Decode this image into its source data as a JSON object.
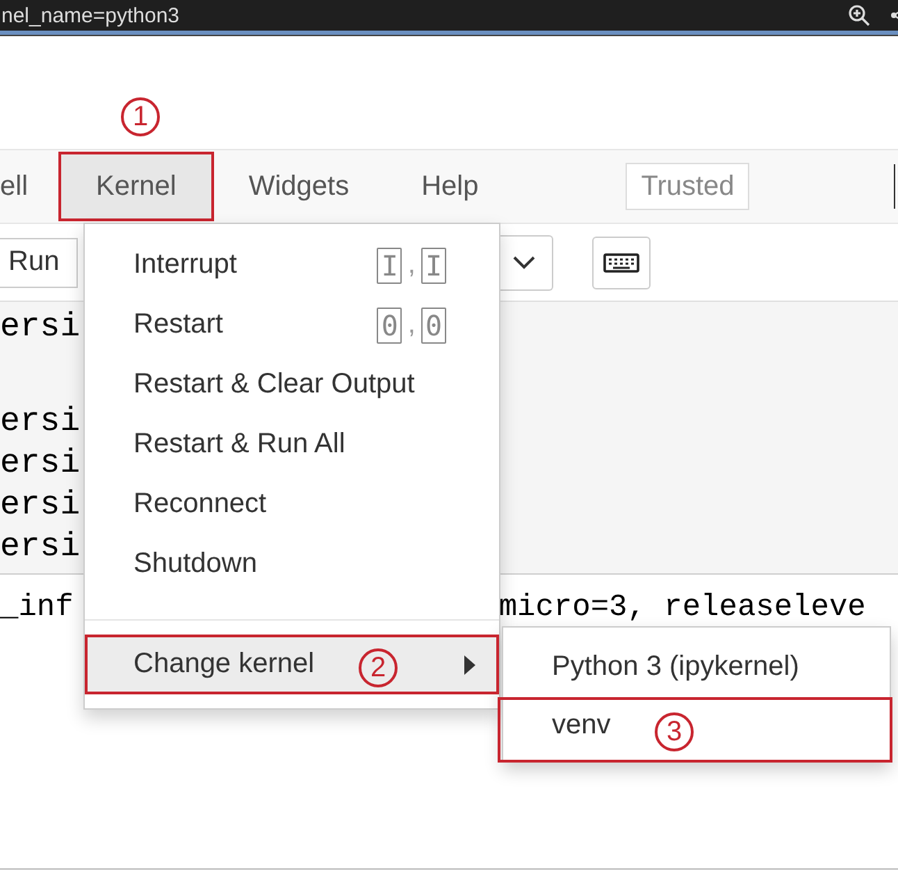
{
  "browser_bar": {
    "url": "nel_name=python3"
  },
  "menubar": {
    "items": [
      {
        "label": "ell",
        "selected": false
      },
      {
        "label": "Kernel",
        "selected": true,
        "annotation": "1"
      },
      {
        "label": "Widgets",
        "selected": false
      },
      {
        "label": "Help",
        "selected": false
      }
    ],
    "trusted": "Trusted"
  },
  "toolbar": {
    "run": "Run"
  },
  "code_lines": [
    {
      "text": "ersi",
      "blank_before": false
    },
    {
      "text": "ersi",
      "blank_before": true
    },
    {
      "text": "ersi",
      "blank_before": false
    },
    {
      "text": "ersi",
      "blank_before": false
    },
    {
      "text": "ersi",
      "blank_before": false
    }
  ],
  "output": {
    "column_1": "_inf",
    "column_2": "micro=3, releaseleve"
  },
  "kernel_menu": {
    "items": [
      {
        "kind": "command",
        "label": "Interrupt",
        "shortcut": [
          "I",
          "I"
        ],
        "separator": ","
      },
      {
        "kind": "command",
        "label": "Restart",
        "shortcut": [
          "0",
          "0"
        ],
        "separator": ","
      },
      {
        "kind": "command",
        "label": "Restart & Clear Output"
      },
      {
        "kind": "command",
        "label": "Restart & Run All"
      },
      {
        "kind": "command",
        "label": "Reconnect"
      },
      {
        "kind": "command",
        "label": "Shutdown"
      },
      {
        "kind": "divider"
      },
      {
        "kind": "submenu",
        "label": "Change kernel",
        "selected": true,
        "annotation": "2"
      }
    ]
  },
  "kernel_submenu": {
    "items": [
      {
        "label": "Python 3 (ipykernel)",
        "selected": false
      },
      {
        "label": "venv",
        "selected": false,
        "annotation": "3"
      }
    ]
  }
}
